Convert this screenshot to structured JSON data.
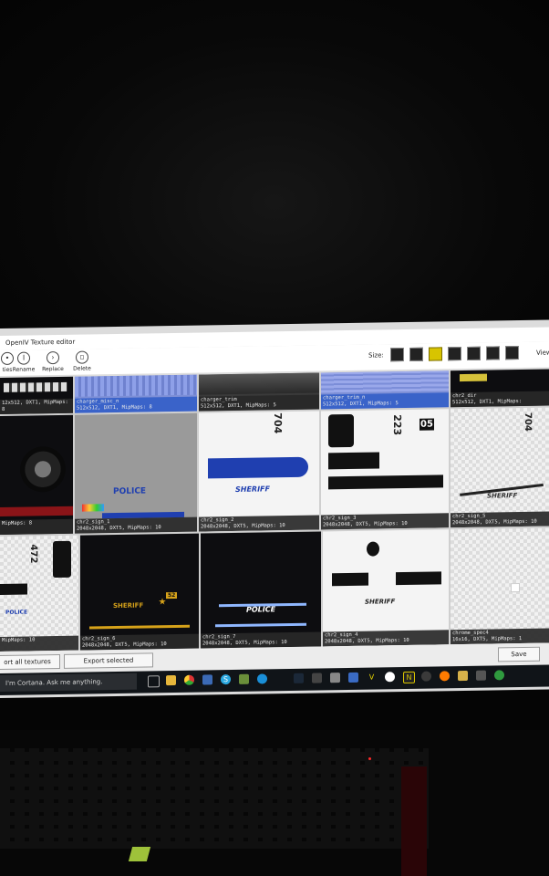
{
  "window": {
    "title": "OpenIV Texture editor"
  },
  "toolbar": {
    "properties_label": "ties",
    "rename_label": "Rename",
    "replace_label": "Replace",
    "delete_label": "Delete",
    "size_label": "Size:",
    "view_label": "View"
  },
  "textures": [
    {
      "name": "",
      "info": "12x512, DXT1, MipMaps: 8"
    },
    {
      "name": "charger_misc_n",
      "info": "512x512, DXT1, MipMaps: 8"
    },
    {
      "name": "charger_trim",
      "info": "512x512, DXT1, MipMaps: 5"
    },
    {
      "name": "charger_trim_n",
      "info": "512x512, DXT1, MipMaps: 5"
    },
    {
      "name": "chr2_dir",
      "info": "512x512, DXT1, MipMaps:"
    },
    {
      "name": "",
      "info": "MipMaps: 8"
    },
    {
      "name": "chr2_sign_1",
      "info": "2048x2048, DXT5, MipMaps: 10"
    },
    {
      "name": "chr2_sign_2",
      "info": "2048x2048, DXT5, MipMaps: 10"
    },
    {
      "name": "chr2_sign_3",
      "info": "2048x2048, DXT5, MipMaps: 10"
    },
    {
      "name": "chr2_sign_5",
      "info": "2048x2048, DXT5, MipMaps: 10"
    },
    {
      "name": "",
      "info": "MipMaps: 10"
    },
    {
      "name": "chr2_sign_6",
      "info": "2048x2048, DXT5, MipMaps: 10"
    },
    {
      "name": "chr2_sign_7",
      "info": "2048x2048, DXT5, MipMaps: 10"
    },
    {
      "name": "chr2_sign_4",
      "info": "2048x2048, DXT5, MipMaps: 10"
    },
    {
      "name": "chrome_spec4",
      "info": "16x16, DXT5, MipMaps: 1"
    }
  ],
  "texture_art": {
    "police": "POLICE",
    "sheriff": "SHERIFF",
    "n704": "704",
    "n223": "223",
    "n05": "05",
    "n472": "472",
    "n52": "52"
  },
  "bottom": {
    "export_all_label": "ort all textures",
    "export_selected_label": "Export selected",
    "save_label": "Save"
  },
  "taskbar": {
    "cortana_placeholder": "I'm Cortana. Ask me anything."
  },
  "colors": {
    "selection": "#3a63c9",
    "size_active": "#d8c400",
    "police_blue": "#1f3fb0"
  }
}
